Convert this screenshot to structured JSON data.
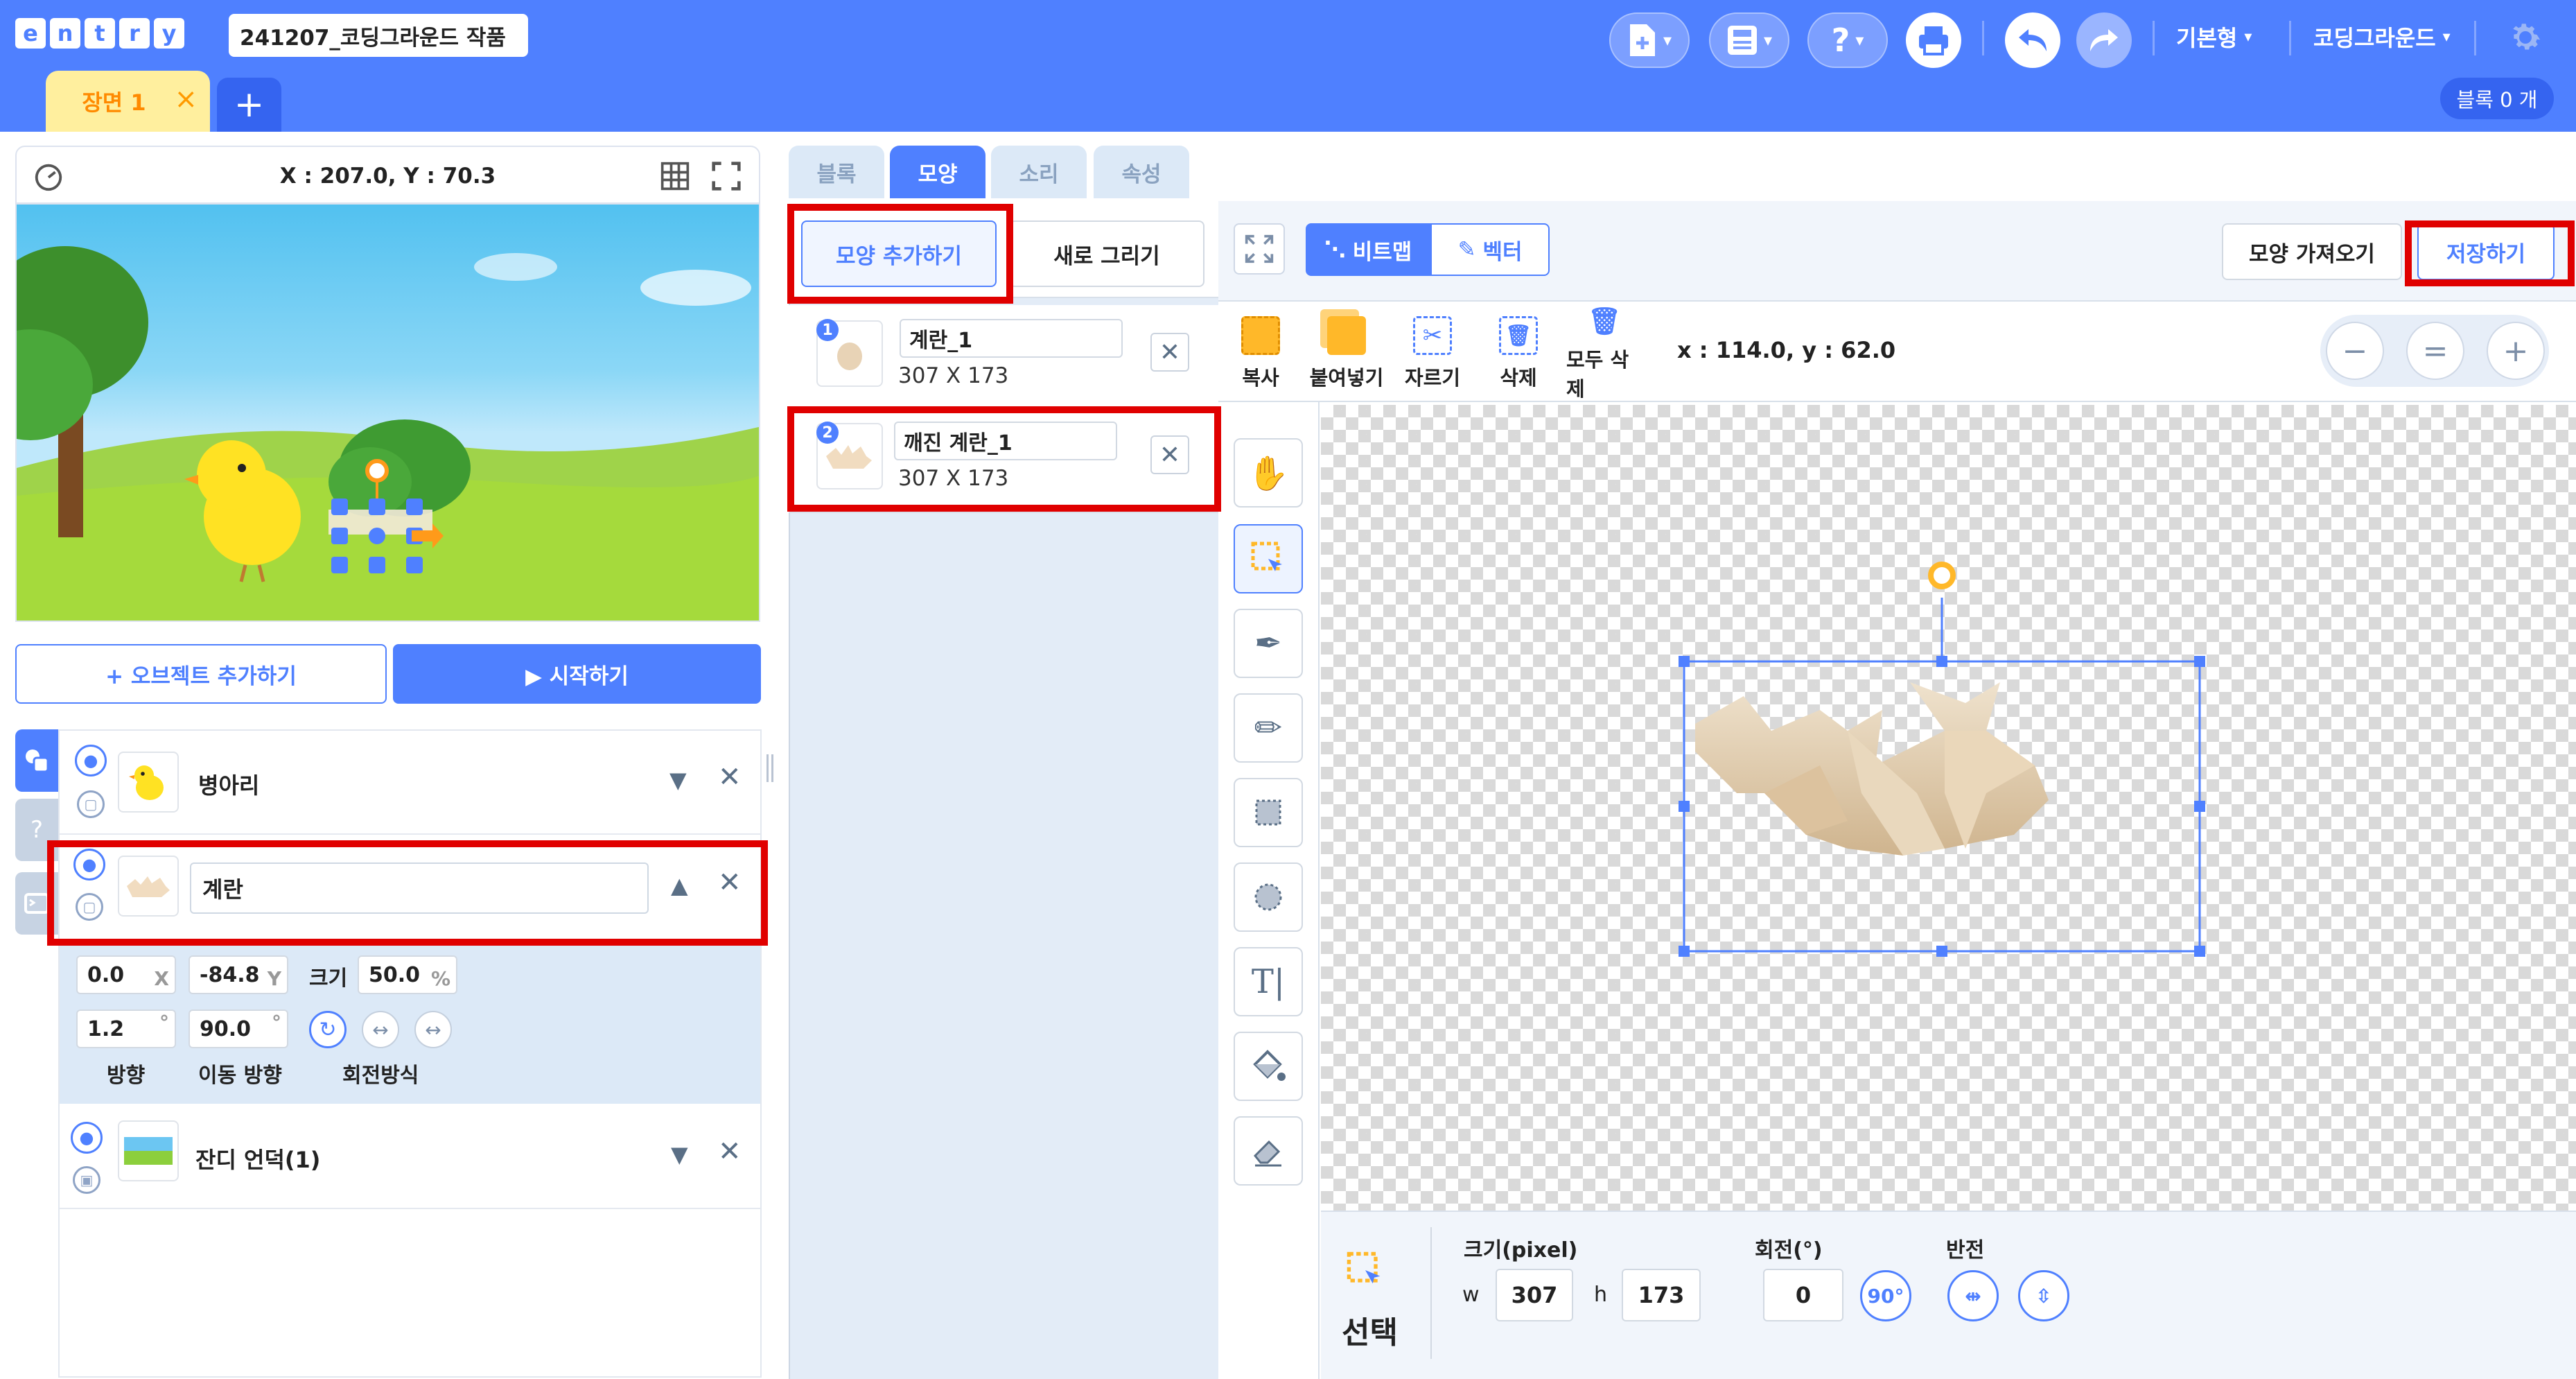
{
  "app": {
    "logo_letters": [
      "e",
      "n",
      "t",
      "r",
      "y"
    ],
    "project_title": "241207_코딩그라운드 작품",
    "mode_menu": "기본형",
    "user_menu": "코딩그라운드",
    "block_count": "블록 0 개",
    "accent": "#4f80ff",
    "highlight_red": "#e00000"
  },
  "header_icons": [
    "new-file-icon",
    "save-icon",
    "help-icon",
    "print-icon",
    "undo-icon",
    "redo-icon",
    "settings-icon"
  ],
  "header_labels": {
    "help": "?"
  },
  "scene": {
    "tab_label": "장면 1",
    "close": "×",
    "add": "+"
  },
  "stage": {
    "coords": "X : 207.0, Y : 70.3",
    "add_object": "+ 오브젝트 추가하기",
    "start": "▶ 시작하기"
  },
  "objects": [
    {
      "name": "병아리"
    },
    {
      "name": "계란",
      "x": "0.0",
      "y": "-84.8",
      "size": "50.0",
      "direction": "1.2",
      "move_direction": "90.0"
    },
    {
      "name": "잔디 언덕(1)"
    }
  ],
  "object_props": {
    "x_unit": "X",
    "y_unit": "Y",
    "size_label": "크기",
    "size_unit": "%",
    "deg": "°",
    "direction_label": "방향",
    "move_direction_label": "이동 방향",
    "rotation_label": "회전방식"
  },
  "tabs": [
    "블록",
    "모양",
    "소리",
    "속성"
  ],
  "shape_panel": {
    "add_shape": "모양 추가하기",
    "new_draw": "새로 그리기",
    "shapes": [
      {
        "index": "1",
        "name": "계란_1",
        "size": "307 X 173"
      },
      {
        "index": "2",
        "name": "깨진 계란_1",
        "size": "307 X 173"
      }
    ]
  },
  "paint": {
    "bitmap": "비트맵",
    "vector": "벡터",
    "import": "모양 가져오기",
    "save": "저장하기",
    "tools": [
      "복사",
      "붙여넣기",
      "자르기",
      "삭제",
      "모두 삭제"
    ],
    "coords": "x : 114.0, y : 62.0",
    "zoom": [
      "−",
      "=",
      "+"
    ],
    "select_label": "선택",
    "size_label": "크기(pixel)",
    "w_label": "w",
    "h_label": "h",
    "width": "307",
    "height": "173",
    "rotate_label": "회전(°)",
    "rotate_value": "0",
    "rotate_90": "90°",
    "flip_label": "반전",
    "text_tool": "T|"
  }
}
